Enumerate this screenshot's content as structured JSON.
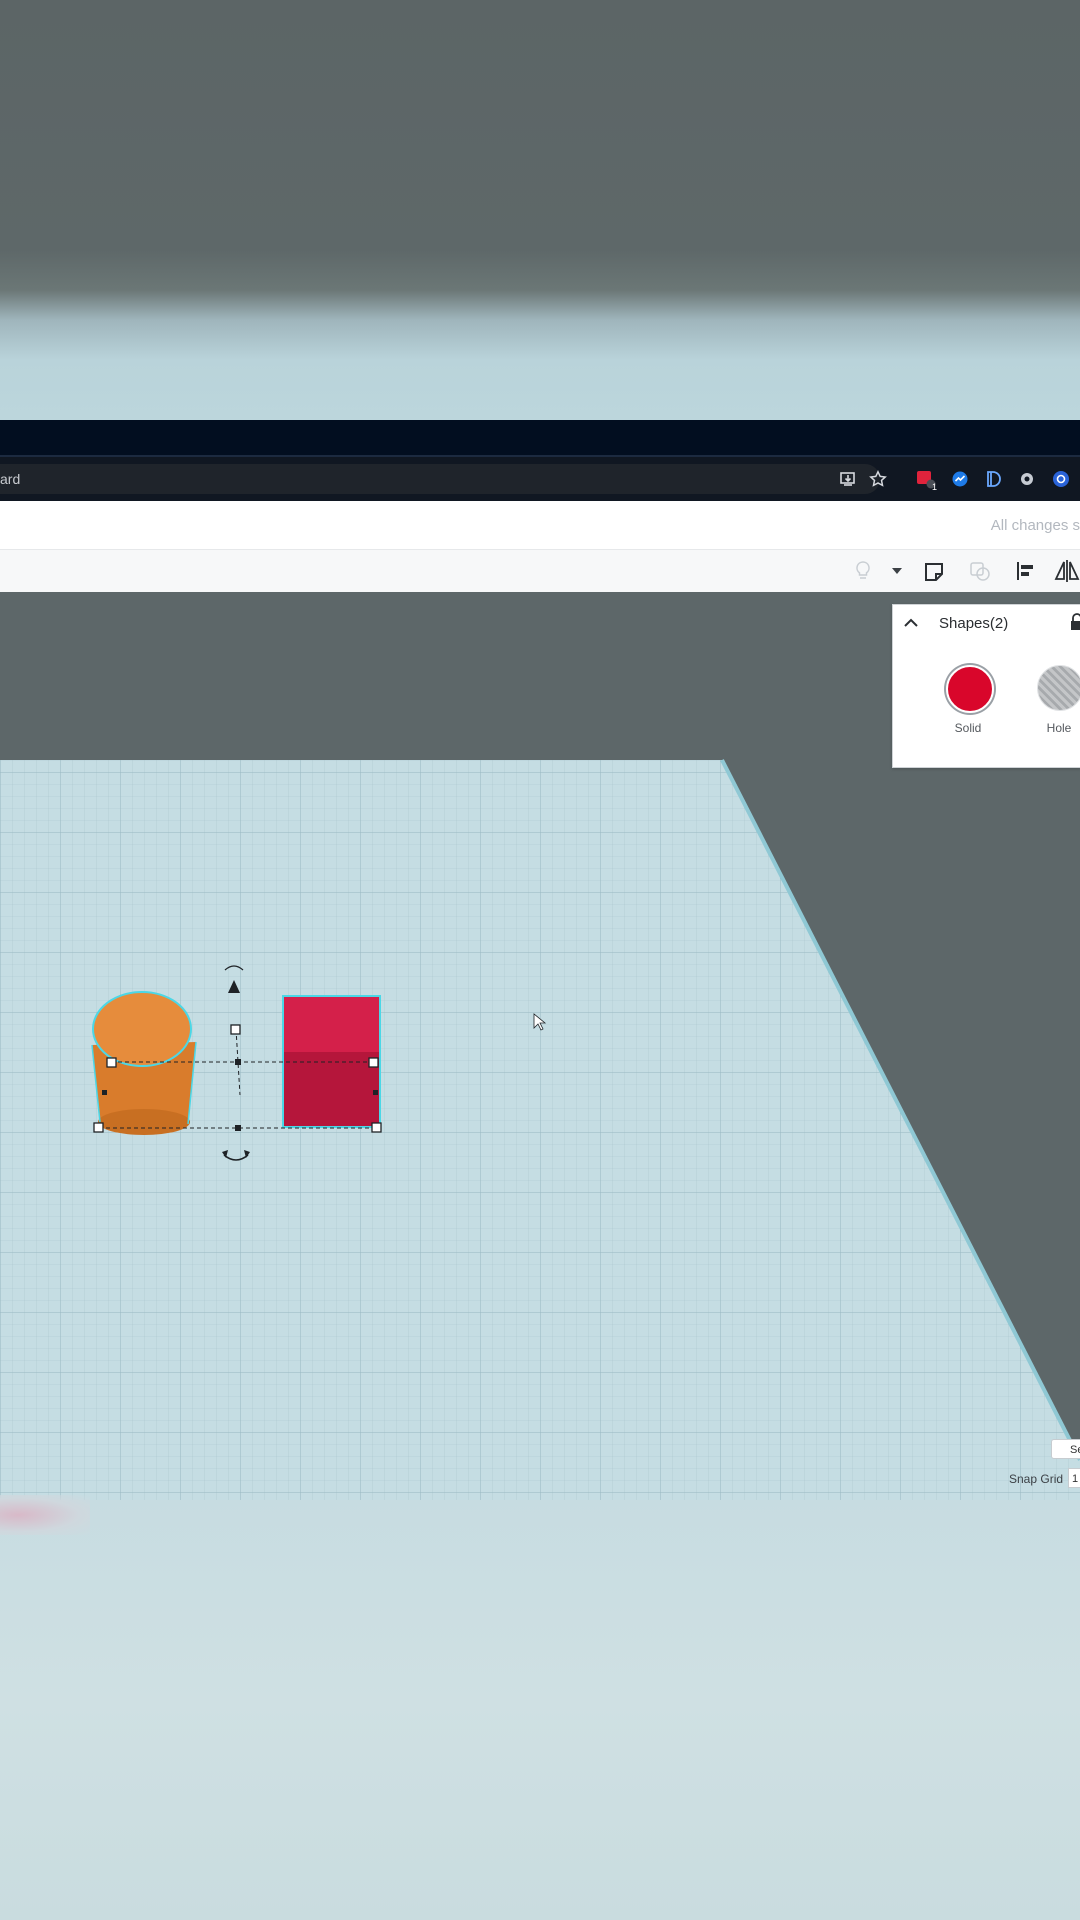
{
  "browser": {
    "url_fragment": "ard",
    "extension_badge": "1"
  },
  "header": {
    "save_status": "All changes s"
  },
  "shapes_panel": {
    "title": "Shapes(2)",
    "solid_label": "Solid",
    "hole_label": "Hole",
    "solid_color": "#d9062b"
  },
  "bottom_controls": {
    "snap_grid_label": "Snap Grid",
    "snap_grid_value": "1",
    "settings_label": "Se"
  },
  "objects": {
    "cylinder_color": "#e68c3c",
    "box_color": "#d11e43",
    "selection_color": "#4bd7e6"
  }
}
